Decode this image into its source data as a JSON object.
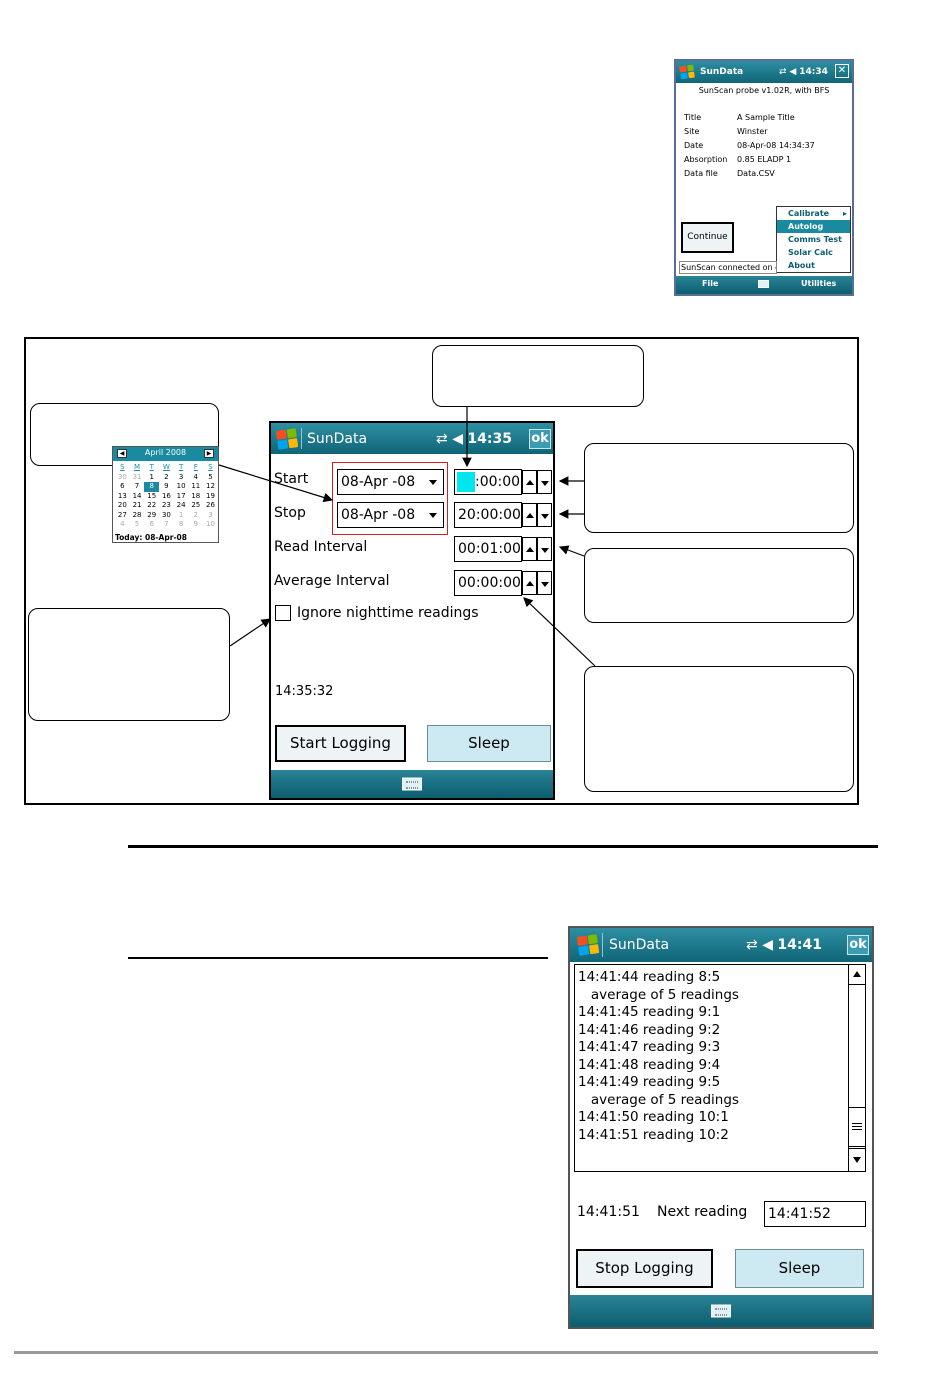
{
  "screen_top": {
    "title": "SunData",
    "time": "14:34",
    "probe_line": "SunScan probe v1.02R, with BFS",
    "rows": [
      {
        "label": "Title",
        "value": "A Sample Title"
      },
      {
        "label": "Site",
        "value": "Winster"
      },
      {
        "label": "Date",
        "value": "08-Apr-08 14:34:37"
      },
      {
        "label": "Absorption",
        "value": "0.85   ELADP  1"
      },
      {
        "label": "Data file",
        "value": "Data.CSV"
      }
    ],
    "continue_label": "Continue",
    "menu": [
      "Calibrate",
      "Autolog",
      "Comms Test",
      "Solar Calc",
      "About"
    ],
    "status_text": "SunScan connected on c",
    "softkey_left": "File",
    "softkey_right": "Utilities"
  },
  "screen_mid": {
    "title": "SunData",
    "time": "14:35",
    "ok": "ok",
    "start_label": "Start",
    "stop_label": "Stop",
    "read_interval_label": "Read Interval",
    "average_interval_label": "Average Interval",
    "start_date": "08-Apr -08",
    "stop_date": "08-Apr -08",
    "start_time": ":00:00",
    "stop_time": "20:00:00",
    "read_interval": "00:01:00",
    "average_interval": "00:00:00",
    "ignore_label": "Ignore nighttime readings",
    "clock": "14:35:32",
    "start_logging_label": "Start Logging",
    "sleep_label": "Sleep"
  },
  "calendar": {
    "month": "April 2008",
    "weekdays": [
      "S",
      "M",
      "T",
      "W",
      "T",
      "F",
      "S"
    ],
    "weeks": [
      [
        "30",
        "31",
        "1",
        "2",
        "3",
        "4",
        "5"
      ],
      [
        "6",
        "7",
        "8",
        "9",
        "10",
        "11",
        "12"
      ],
      [
        "13",
        "14",
        "15",
        "16",
        "17",
        "18",
        "19"
      ],
      [
        "20",
        "21",
        "22",
        "23",
        "24",
        "25",
        "26"
      ],
      [
        "27",
        "28",
        "29",
        "30",
        "1",
        "2",
        "3"
      ],
      [
        "4",
        "5",
        "6",
        "7",
        "8",
        "9",
        "10"
      ]
    ],
    "today": "Today: 08-Apr-08"
  },
  "screen_log": {
    "title": "SunData",
    "time": "14:41",
    "ok": "ok",
    "log_lines": [
      "14:41:44 reading 8:5",
      "   average of 5 readings",
      "14:41:45 reading 9:1",
      "14:41:46 reading 9:2",
      "14:41:47 reading 9:3",
      "14:41:48 reading 9:4",
      "14:41:49 reading 9:5",
      "   average of 5 readings",
      "14:41:50 reading 10:1",
      "14:41:51 reading 10:2"
    ],
    "current_time": "14:41:51",
    "next_reading_label": "Next reading",
    "next_reading_value": "14:41:52",
    "stop_logging_label": "Stop Logging",
    "sleep_label": "Sleep"
  },
  "colors": {
    "titlebar": "#1a7486",
    "highlight": "#00e5ee",
    "button_light": "#cde9f2",
    "callout_red": "#d02020"
  }
}
